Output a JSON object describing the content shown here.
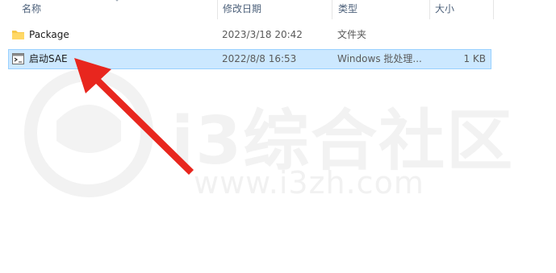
{
  "columns": {
    "name": "名称",
    "date": "修改日期",
    "type": "类型",
    "size": "大小"
  },
  "files": [
    {
      "name": "Package",
      "date": "2023/3/18 20:42",
      "type": "文件夹",
      "size": "",
      "icon": "folder-icon",
      "selected": false
    },
    {
      "name": "启动SAE",
      "date": "2022/8/8 16:53",
      "type": "Windows 批处理...",
      "size": "1 KB",
      "icon": "batch-file-icon",
      "selected": true
    }
  ],
  "watermark": {
    "text": "i3综合社区",
    "url": "www.i3zh.com"
  },
  "colors": {
    "selection": "#cce8ff",
    "folder": "#f7c84a",
    "arrow": "#e8261e"
  }
}
